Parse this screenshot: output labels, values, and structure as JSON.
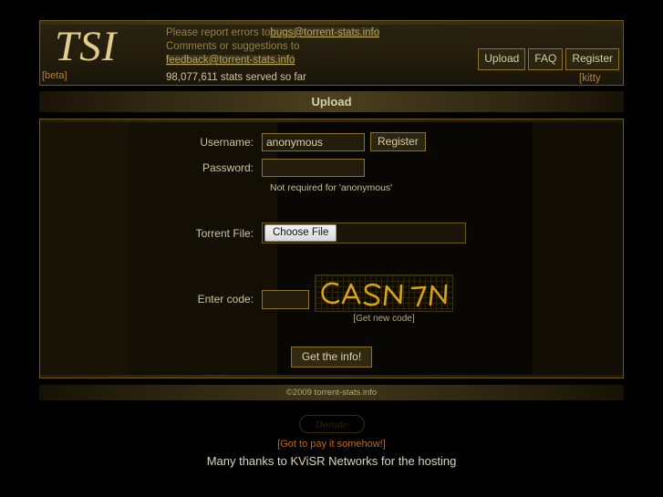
{
  "site": {
    "logo": "TSI",
    "beta": "[beta]",
    "report_prefix": "Please report errors to",
    "bugs_email": "bugs@torrent-stats.info",
    "comments_prefix": "Comments or suggestions to",
    "feedback_email": "feedback@torrent-stats.info",
    "stats_served": "98,077,611 stats served so far"
  },
  "nav": {
    "upload": "Upload",
    "faq": "FAQ",
    "register": "Register",
    "kitty_kode": "[kitty kode]"
  },
  "page": {
    "title": "Upload"
  },
  "form": {
    "username_label": "Username:",
    "username_value": "anonymous",
    "username_placeholder": "",
    "register_button": "Register",
    "password_label": "Password:",
    "password_value": "",
    "password_placeholder": "",
    "password_hint": "Not required for 'anonymous'",
    "torrent_label": "Torrent File:",
    "choose_file_button": "Choose File",
    "file_name": "",
    "code_label": "Enter code:",
    "code_value": "",
    "code_placeholder": "",
    "captcha_text": "CASN7N",
    "get_new_code": "[Get new code]",
    "submit_button": "Get the info!"
  },
  "footer": {
    "copyright": "©2009 torrent-stats.info",
    "donate_button": "Donate",
    "donate_note": "[Got to pay it somehow!]",
    "hosting_credit": "Many thanks to KViSR Networks for the hosting"
  },
  "colors": {
    "gold": "#e3cd8a",
    "border_gold": "#8a7327",
    "accent_orange": "#b3823a",
    "link_orange": "#c06a14",
    "panel_bg": "#0a0804",
    "page_bg": "#000000"
  }
}
